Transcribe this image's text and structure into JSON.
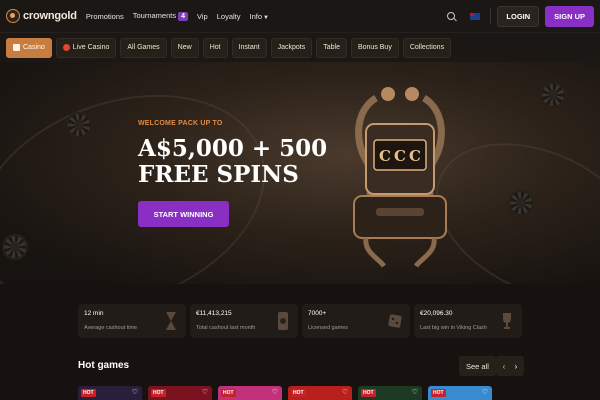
{
  "brand": {
    "name": "crowngold"
  },
  "topnav": {
    "items": [
      "Promotions",
      "Tournaments",
      "Vip",
      "Loyalty",
      "Info"
    ],
    "tournaments_badge": "4"
  },
  "auth": {
    "login": "LOGIN",
    "signup": "SIGN UP"
  },
  "categories": [
    {
      "label": "Casino",
      "active": true,
      "icon": "casino-icon"
    },
    {
      "label": "Live Casino",
      "active": false,
      "icon": "live-icon"
    },
    {
      "label": "All Games",
      "active": false
    },
    {
      "label": "New",
      "active": false
    },
    {
      "label": "Hot",
      "active": false
    },
    {
      "label": "Instant",
      "active": false
    },
    {
      "label": "Jackpots",
      "active": false
    },
    {
      "label": "Table",
      "active": false
    },
    {
      "label": "Bonus Buy",
      "active": false
    },
    {
      "label": "Collections",
      "active": false
    }
  ],
  "hero": {
    "eyebrow": "WELCOME PACK UP TO",
    "headline_line1": "A$5,000 + 500",
    "headline_line2": "FREE SPINS",
    "cta": "START WINNING"
  },
  "stats": [
    {
      "value": "12 min",
      "label": "Average cashout time",
      "icon": "hourglass-icon"
    },
    {
      "value": "€11,413,215",
      "label": "Total cashout last month",
      "icon": "phone-coin-icon"
    },
    {
      "value": "7000+",
      "label": "Licensed games",
      "icon": "dice-icon"
    },
    {
      "value": "€20,096.30",
      "label": "Last big win in Viking Clash",
      "icon": "trophy-icon"
    }
  ],
  "hot_games": {
    "title": "Hot games",
    "see_all": "See all",
    "badge": "HOT",
    "tiles": [
      {
        "color": "#2a1f3a"
      },
      {
        "color": "#7a1220"
      },
      {
        "color": "#c2327a"
      },
      {
        "color": "#b8201c"
      },
      {
        "color": "#1d3a24"
      },
      {
        "color": "#3a8ad0"
      }
    ]
  },
  "colors": {
    "accent_purple": "#8a2fc4",
    "accent_orange": "#c77d3e",
    "hot_red": "#c4232a"
  }
}
